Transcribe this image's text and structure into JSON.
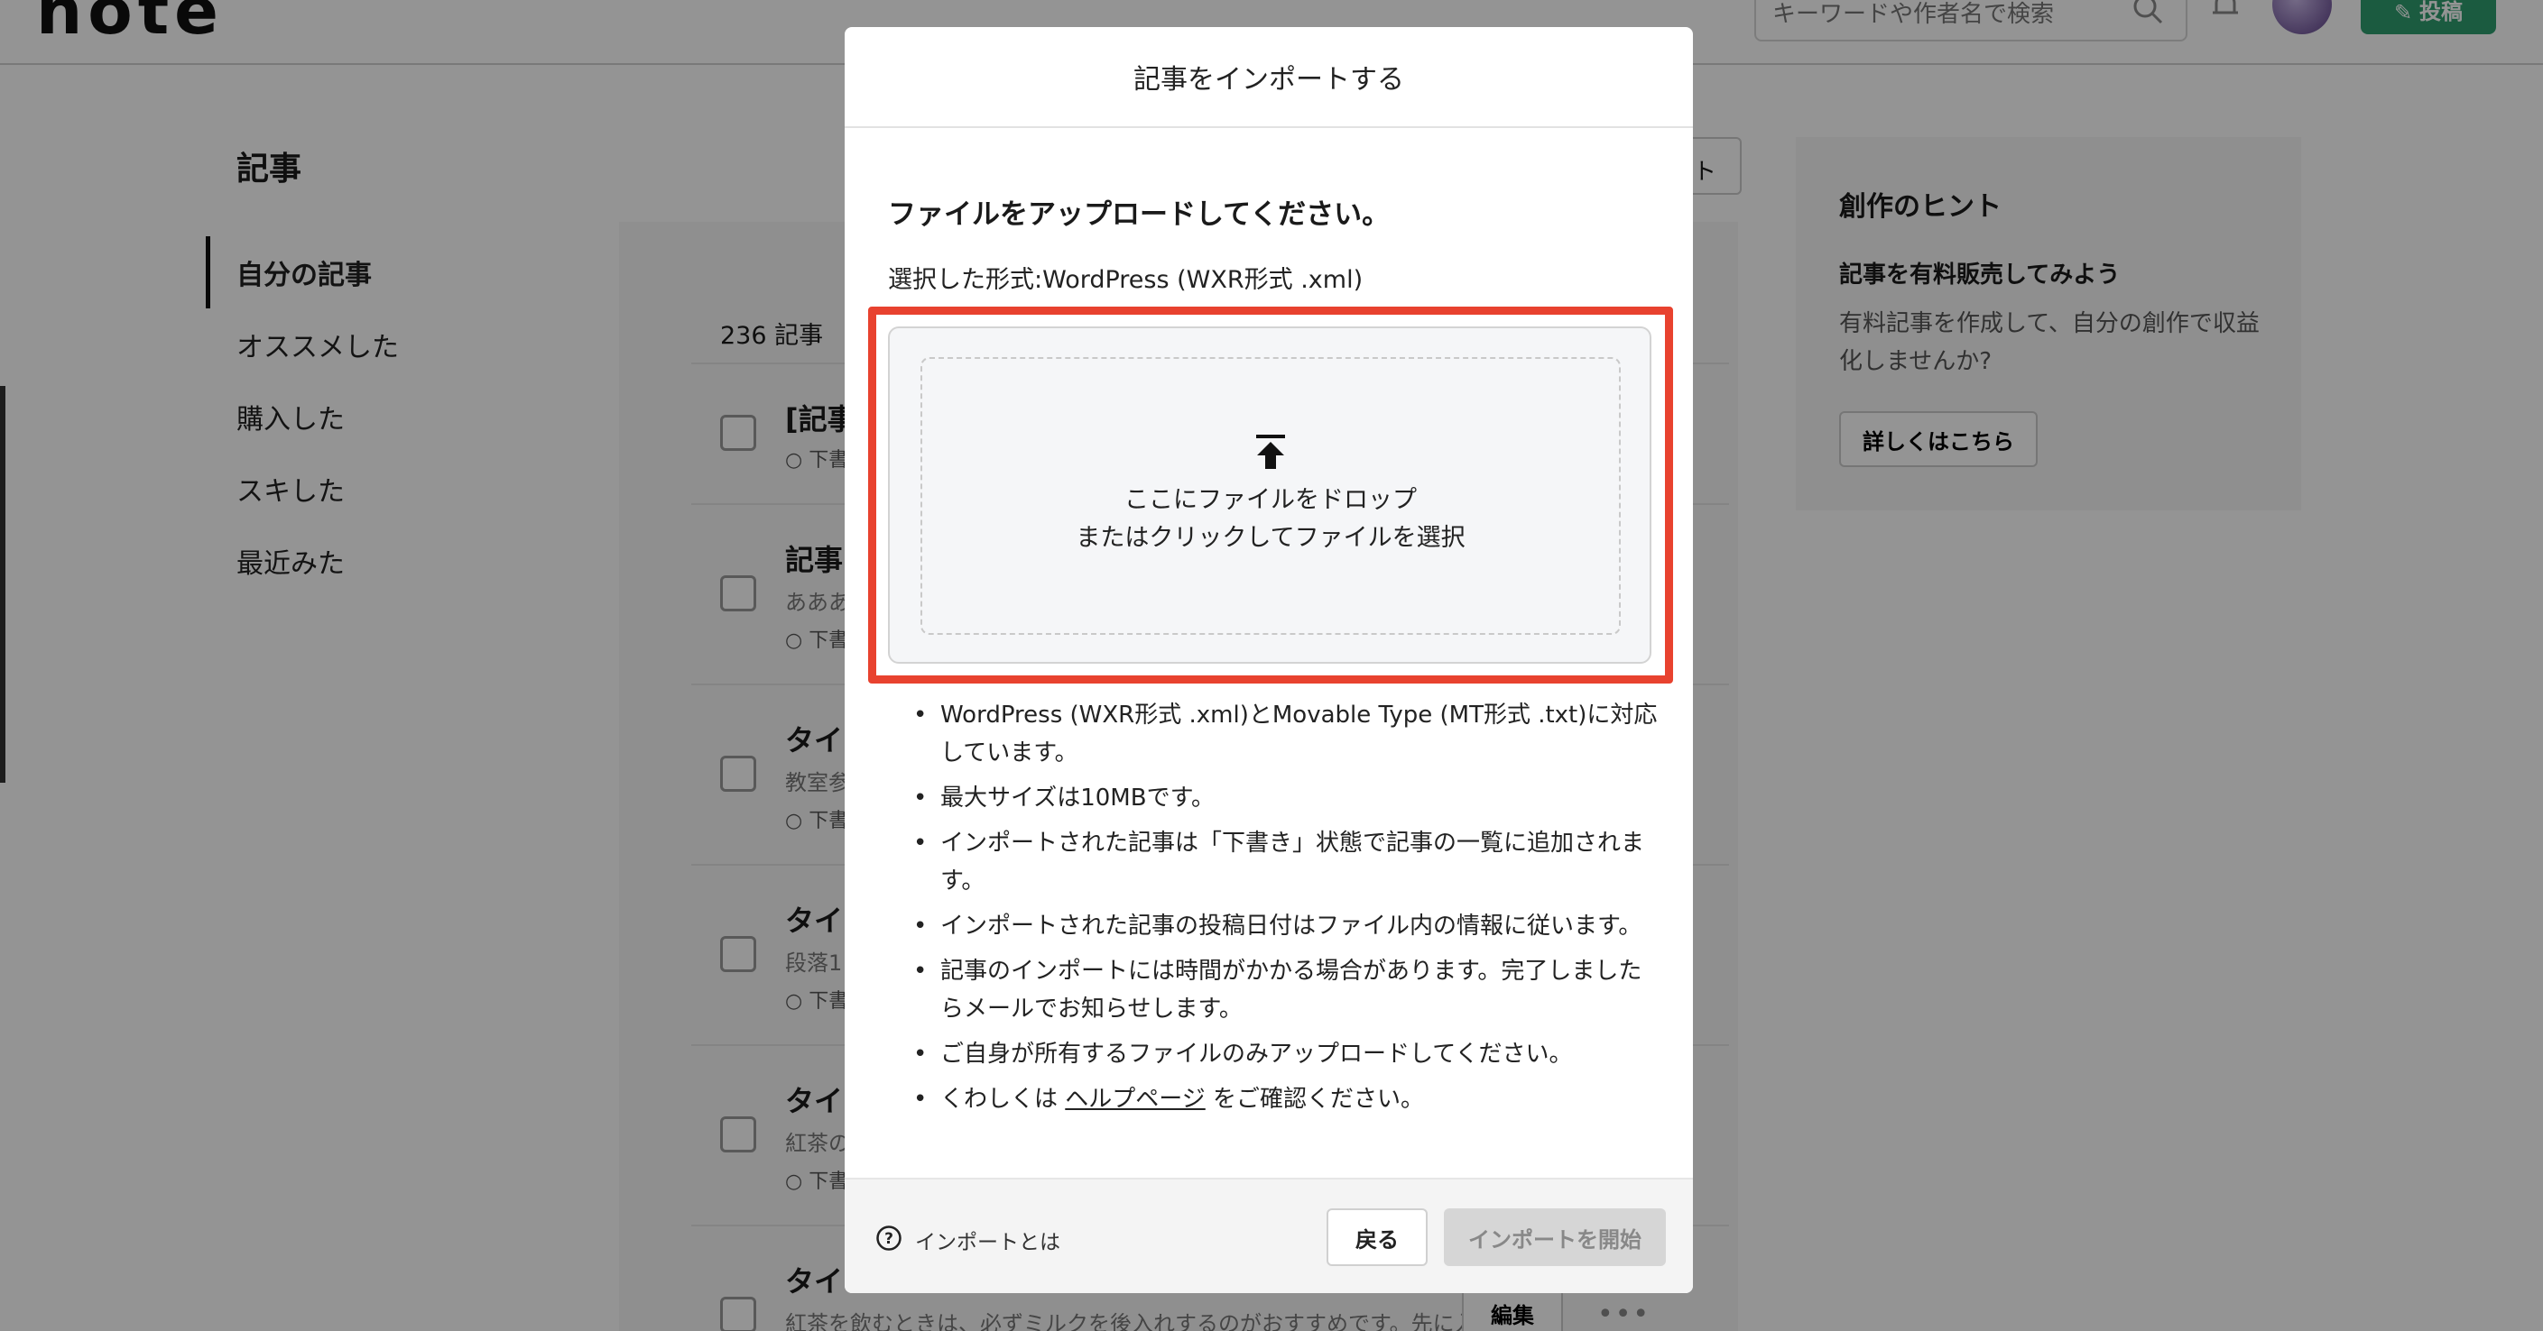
{
  "header": {
    "logo": "note",
    "search_placeholder": "キーワードや作者名で検索",
    "post_label": "投稿"
  },
  "sidebar": {
    "title": "記事",
    "items": [
      {
        "label": "自分の記事",
        "active": true
      },
      {
        "label": "オススメした",
        "active": false
      },
      {
        "label": "購入した",
        "active": false
      },
      {
        "label": "スキした",
        "active": false
      },
      {
        "label": "最近みた",
        "active": false
      }
    ]
  },
  "article_list": {
    "count_label": "236 記事",
    "partial_button_label": "ト",
    "rows": [
      {
        "title": "[記事",
        "snippet": "",
        "status": "○ 下書"
      },
      {
        "title": "記事",
        "snippet": "あああ",
        "status": "○ 下書"
      },
      {
        "title": "タイ",
        "snippet": "教室参",
        "status": "○ 下書"
      },
      {
        "title": "タイ",
        "snippet": "段落1:",
        "status": "○ 下書"
      },
      {
        "title": "タイ",
        "snippet": "紅茶の",
        "status": "○ 下書"
      },
      {
        "title": "タイ",
        "snippet": "紅茶を飲むときは、必ずミルクを後入れするのがおすすめです。先に入...",
        "status": ""
      }
    ],
    "edit_label": "編集",
    "more_label": "•••"
  },
  "hint_panel": {
    "title": "創作のヒント",
    "subtitle": "記事を有料販売してみよう",
    "text": "有料記事を作成して、自分の創作で収益化しませんか?",
    "button_label": "詳しくはこちら"
  },
  "modal": {
    "title": "記事をインポートする",
    "instruction": "ファイルをアップロードしてください。",
    "selected_format": "選択した形式:WordPress (WXR形式 .xml)",
    "dropzone": {
      "line1": "ここにファイルをドロップ",
      "line2": "またはクリックしてファイルを選択",
      "icon": "upload-icon"
    },
    "notes": [
      "WordPress (WXR形式 .xml)とMovable Type (MT形式 .txt)に対応しています。",
      "最大サイズは10MBです。",
      "インポートされた記事は「下書き」状態で記事の一覧に追加されます。",
      "インポートされた記事の投稿日付はファイル内の情報に従います。",
      "記事のインポートには時間がかかる場合があります。完了しましたらメールでお知らせします。",
      "ご自身が所有するファイルのみアップロードしてください。"
    ],
    "help_note": {
      "prefix": "くわしくは",
      "link": "ヘルプページ",
      "suffix": "をご確認ください。"
    },
    "footer": {
      "help_text": "インポートとは",
      "back_label": "戻る",
      "start_label": "インポートを開始"
    }
  },
  "colors": {
    "highlight": "#e8422f",
    "brand_green": "#2f9e6f",
    "overlay": "rgba(0,0,0,0.42)"
  }
}
